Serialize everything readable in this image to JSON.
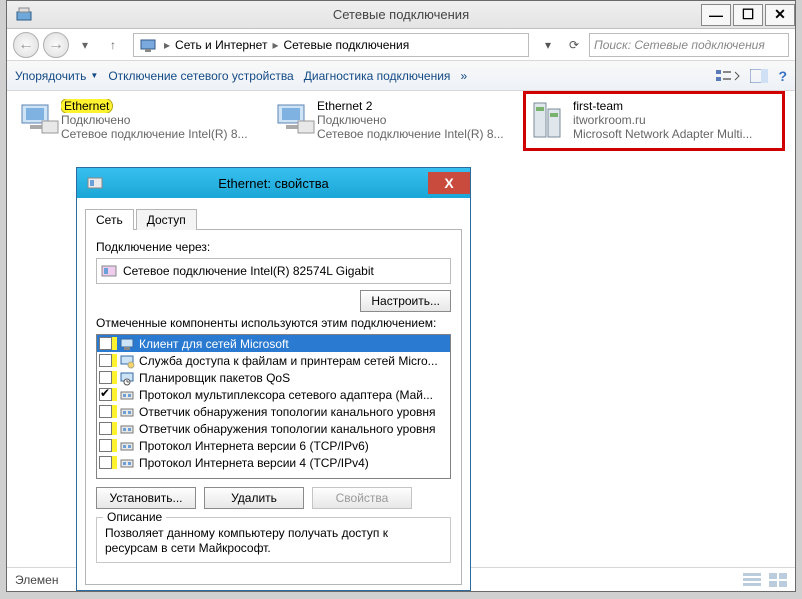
{
  "window": {
    "title": "Сетевые подключения",
    "breadcrumb": {
      "lvl1": "Сеть и Интернет",
      "lvl2": "Сетевые подключения"
    },
    "search_placeholder": "Поиск: Сетевые подключения"
  },
  "toolbar": {
    "organize": "Упорядочить",
    "disable_device": "Отключение сетевого устройства",
    "diagnose": "Диагностика подключения",
    "overflow": "»"
  },
  "connections": [
    {
      "name": "Ethernet",
      "status": "Подключено",
      "adapter": "Сетевое подключение Intel(R) 8...",
      "highlight": true
    },
    {
      "name": "Ethernet 2",
      "status": "Подключено",
      "adapter": "Сетевое подключение Intel(R) 8..."
    },
    {
      "name": "first-team",
      "line2": "itworkroom.ru",
      "line3": "Microsoft Network Adapter Multi...",
      "boxed": true
    }
  ],
  "statusbar": {
    "left": "Элемен"
  },
  "props": {
    "title": "Ethernet: свойства",
    "tabs": {
      "net": "Сеть",
      "access": "Доступ"
    },
    "connect_via_label": "Подключение через:",
    "adapter": "Сетевое подключение Intel(R) 82574L Gigabit",
    "configure": "Настроить...",
    "list_caption": "Отмеченные компоненты используются этим подключением:",
    "components": [
      {
        "label": "Клиент для сетей Microsoft",
        "checked": false,
        "selected": true,
        "icon": "client"
      },
      {
        "label": "Служба доступа к файлам и принтерам сетей Micro...",
        "checked": false,
        "icon": "share"
      },
      {
        "label": "Планировщик пакетов QoS",
        "checked": false,
        "icon": "sched"
      },
      {
        "label": "Протокол мультиплексора сетевого адаптера (Май...",
        "checked": true,
        "icon": "proto"
      },
      {
        "label": "Ответчик обнаружения топологии канального уровня",
        "checked": false,
        "icon": "proto"
      },
      {
        "label": "Ответчик обнаружения топологии канального уровня",
        "checked": false,
        "icon": "proto"
      },
      {
        "label": "Протокол Интернета версии 6 (TCP/IPv6)",
        "checked": false,
        "icon": "proto"
      },
      {
        "label": "Протокол Интернета версии 4 (TCP/IPv4)",
        "checked": false,
        "icon": "proto"
      }
    ],
    "install": "Установить...",
    "uninstall": "Удалить",
    "properties": "Свойства",
    "description_legend": "Описание",
    "description": "Позволяет данному компьютеру получать доступ к ресурсам в сети Майкрософт."
  }
}
